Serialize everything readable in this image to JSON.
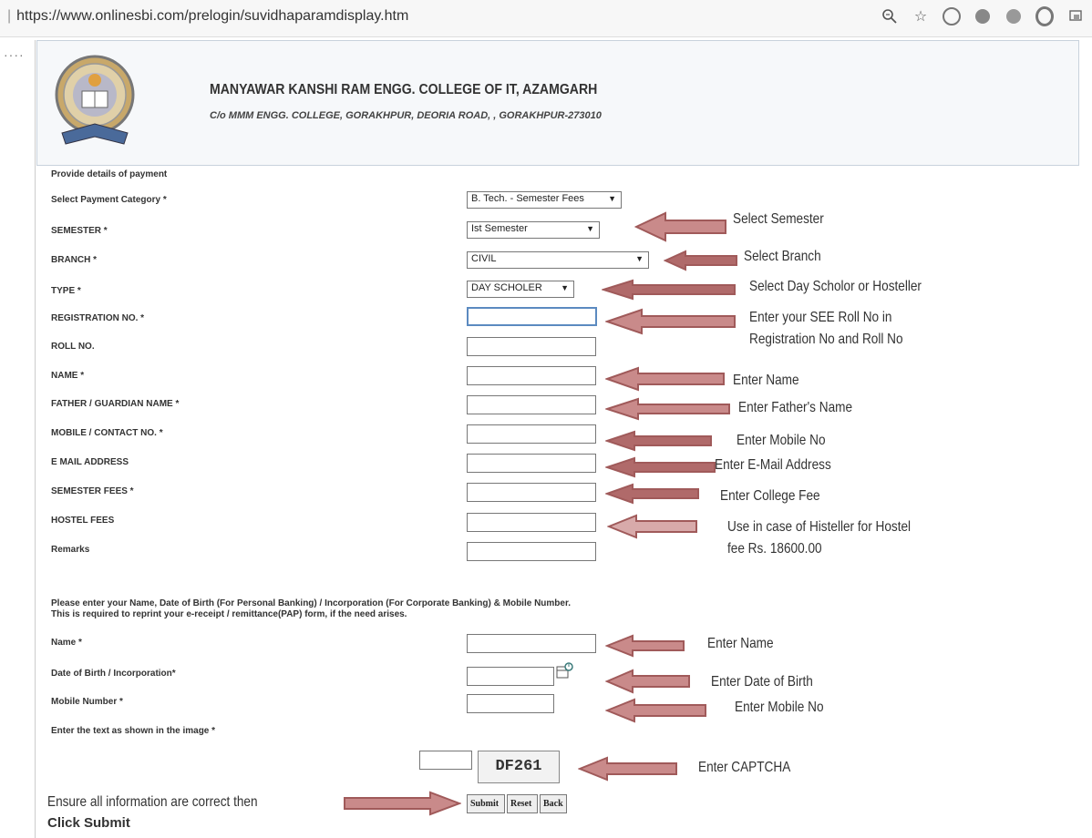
{
  "browser": {
    "url": "https://www.onlinesbi.com/prelogin/suvidhaparamdisplay.htm"
  },
  "header": {
    "college_name": "MANYAWAR KANSHI RAM ENGG. COLLEGE OF IT, AZAMGARH",
    "address": "C/o MMM ENGG. COLLEGE, GORAKHPUR, DEORIA ROAD, , GORAKHPUR-273010"
  },
  "form": {
    "section_title": "Provide details of payment",
    "fields": [
      {
        "label": "Select Payment Category *",
        "value": "B. Tech. - Semester Fees"
      },
      {
        "label": "SEMESTER *",
        "value": "Ist Semester"
      },
      {
        "label": "BRANCH *",
        "value": "CIVIL"
      },
      {
        "label": "TYPE *",
        "value": "DAY SCHOLER"
      },
      {
        "label": "REGISTRATION NO. *",
        "value": ""
      },
      {
        "label": "ROLL NO.",
        "value": ""
      },
      {
        "label": "NAME *",
        "value": ""
      },
      {
        "label": "FATHER / GUARDIAN NAME *",
        "value": ""
      },
      {
        "label": "MOBILE / CONTACT NO. *",
        "value": ""
      },
      {
        "label": "E MAIL ADDRESS",
        "value": ""
      },
      {
        "label": "SEMESTER FEES *",
        "value": ""
      },
      {
        "label": "HOSTEL FEES",
        "value": ""
      },
      {
        "label": "Remarks",
        "value": ""
      }
    ],
    "notice_line1": "Please enter your Name, Date of Birth (For Personal Banking) / Incorporation (For Corporate Banking)  & Mobile Number.",
    "notice_line2": "This is required to reprint your e-receipt / remittance(PAP) form, if the need arises.",
    "reprint": [
      {
        "label": "Name *"
      },
      {
        "label": "Date of Birth / Incorporation*"
      },
      {
        "label": "Mobile Number *"
      },
      {
        "label": "Enter the text as shown in the image *"
      }
    ],
    "captcha_text": "DF261",
    "buttons": {
      "submit": "Submit",
      "reset": "Reset",
      "back": "Back"
    }
  },
  "annotations": {
    "semester": "Select Semester",
    "branch": "Select Branch",
    "type": "Select Day Scholor or Hosteller",
    "roll_1": "Enter your SEE Roll No in",
    "roll_2": "Registration No and Roll No",
    "name": "Enter Name",
    "father": "Enter Father's Name",
    "mobile": "Enter Mobile No",
    "email": "Enter E-Mail Address",
    "fee": "Enter College Fee",
    "hostel_1": "Use in case of Histeller for Hostel",
    "hostel_2": "fee Rs. 18600.00",
    "name2": "Enter Name",
    "dob": "Enter Date of Birth",
    "mobile2": "Enter Mobile No",
    "captcha": "Enter CAPTCHA",
    "ensure": "Ensure all information are correct then",
    "click_submit": "Click Submit"
  },
  "colors": {
    "arrow": "#a05a5a",
    "arrow_fill": "#c98a8a"
  }
}
